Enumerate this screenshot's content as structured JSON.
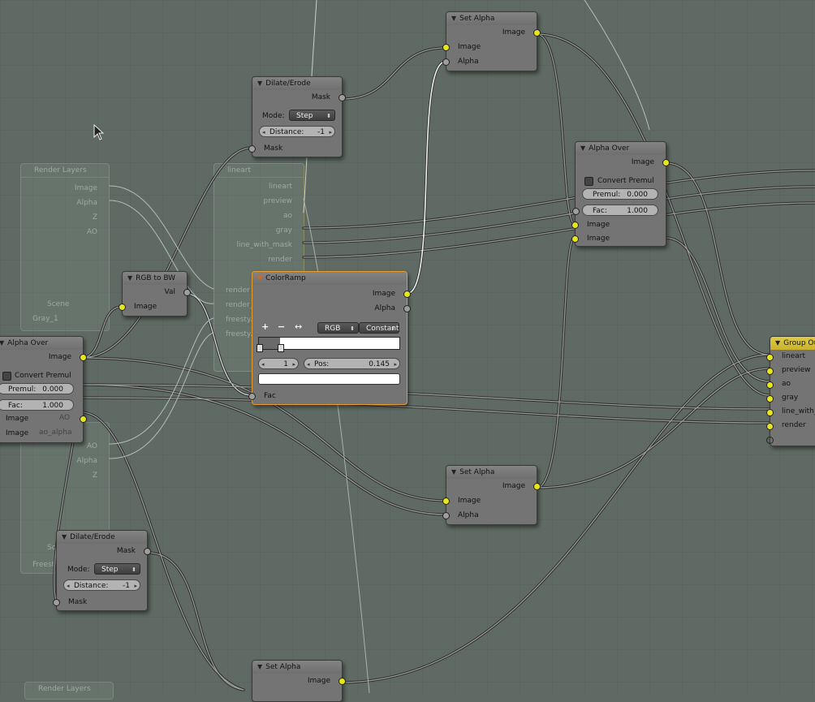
{
  "ghost_nodes": {
    "render_layers": {
      "title": "Render Layers",
      "outputs": [
        "Image",
        "Alpha",
        "Z",
        "AO"
      ],
      "scene": "Scene",
      "layer": "Gray_1"
    },
    "lineart": {
      "title": "lineart",
      "outputs": [
        "lineart",
        "preview",
        "ao",
        "gray",
        "line_with_mask",
        "render"
      ],
      "inputs": [
        "render",
        "render_...",
        "freesty...",
        "freesty..."
      ]
    },
    "render_layers_2": {
      "outputs": [
        "AO",
        "Alpha",
        "Z"
      ],
      "field": "Sc...",
      "layer": "Freesty..."
    },
    "render_layers_3": {
      "title": "Render Layers"
    },
    "alpha_over_hidden_labels": [
      "AO",
      "ao_alpha"
    ]
  },
  "nodes": {
    "set_alpha_1": {
      "title": "Set Alpha",
      "out_image": "Image",
      "in_image": "Image",
      "in_alpha": "Alpha"
    },
    "dilate_erode_1": {
      "title": "Dilate/Erode",
      "out_mask": "Mask",
      "mode_label": "Mode:",
      "mode_value": "Step",
      "distance_label": "Distance:",
      "distance_value": "-1",
      "in_mask": "Mask"
    },
    "alpha_over_right": {
      "title": "Alpha Over",
      "out_image": "Image",
      "convert_premul": "Convert Premul",
      "premul_label": "Premul:",
      "premul_value": "0.000",
      "fac_label": "Fac:",
      "fac_value": "1.000",
      "in_image_1": "Image",
      "in_image_2": "Image"
    },
    "rgb_to_bw": {
      "title": "RGB to BW",
      "out_val": "Val",
      "in_image": "Image"
    },
    "color_ramp": {
      "title": "ColorRamp",
      "out_image": "Image",
      "out_alpha": "Alpha",
      "add": "+",
      "remove": "−",
      "flip": "↔",
      "color_mode": "RGB",
      "interpolation": "Constant",
      "stop_index": "1",
      "pos_label": "Pos:",
      "pos_value": "0.145",
      "in_fac": "Fac"
    },
    "alpha_over_left": {
      "title": "Alpha Over",
      "out_image": "Image",
      "convert_premul": "Convert Premul",
      "premul_label": "Premul:",
      "premul_value": "0.000",
      "fac_label": "Fac:",
      "fac_value": "1.000",
      "in_image_1": "Image",
      "in_image_2": "Image"
    },
    "group_output": {
      "title": "Group Ou",
      "inputs": [
        "lineart",
        "preview",
        "ao",
        "gray",
        "line_with_m",
        "render"
      ]
    },
    "set_alpha_2": {
      "title": "Set Alpha",
      "out_image": "Image",
      "in_image": "Image",
      "in_alpha": "Alpha"
    },
    "dilate_erode_2": {
      "title": "Dilate/Erode",
      "out_mask": "Mask",
      "mode_label": "Mode:",
      "mode_value": "Step",
      "distance_label": "Distance:",
      "distance_value": "-1",
      "in_mask": "Mask"
    },
    "set_alpha_3": {
      "title": "Set Alpha",
      "out_image": "Image"
    }
  },
  "colors": {
    "background": "#5e6a63",
    "node_body": "#747474",
    "socket_color": "#e6e61e",
    "socket_gray": "#9e9e9e",
    "selected_border": "#e89a2b",
    "group_output_header": "#d9c23a"
  },
  "icons": [
    "cursor-arrow-icon",
    "collapse-triangle-icon"
  ]
}
